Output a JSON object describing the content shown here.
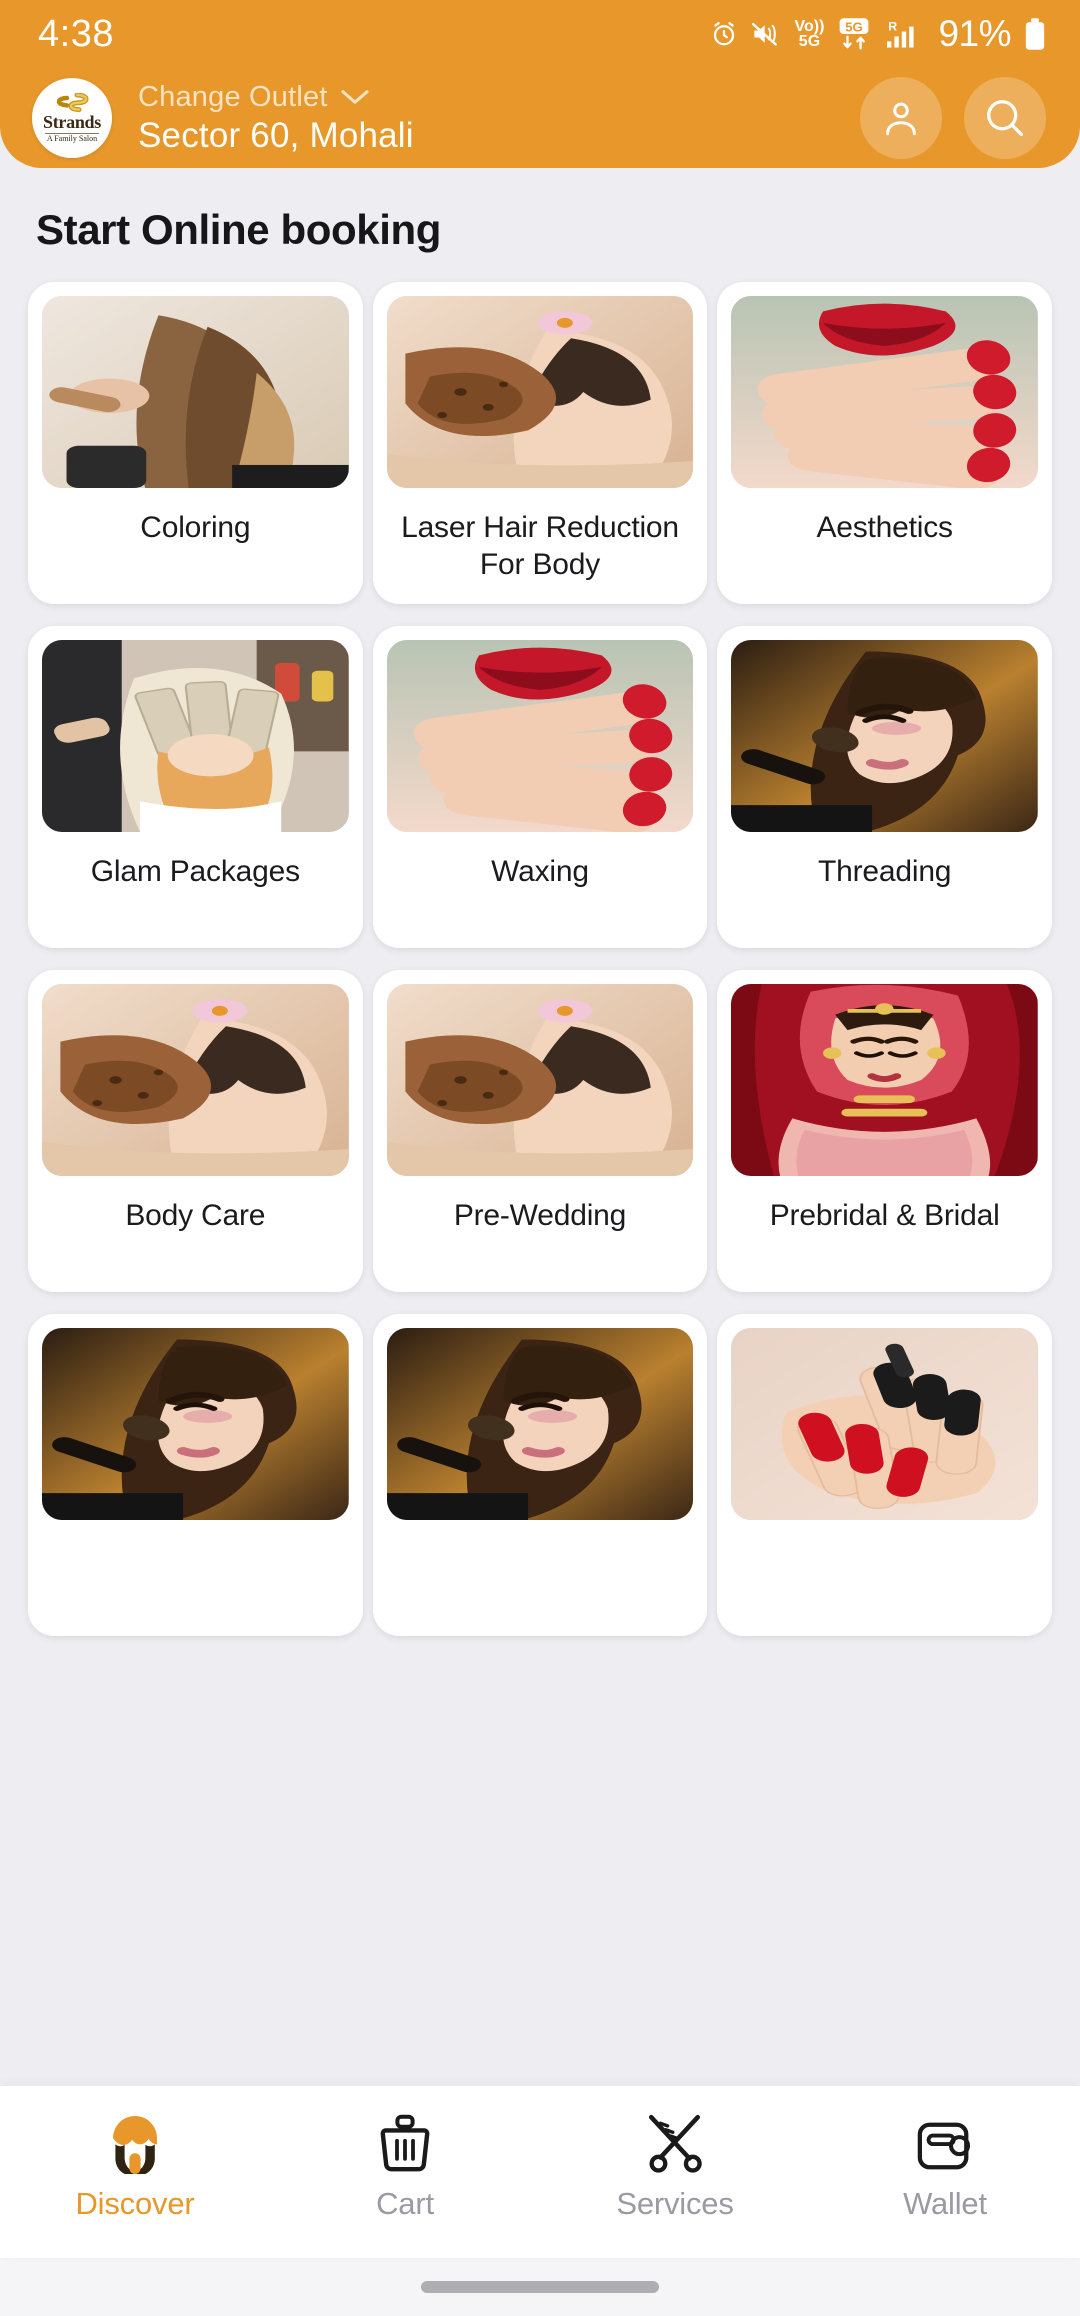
{
  "status_bar": {
    "time": "4:38",
    "battery_percent": "91%",
    "icons": [
      "alarm-icon",
      "mute-icon",
      "volte-5g-icon",
      "5g-data-icon",
      "roaming-signal-icon",
      "battery-icon"
    ],
    "background_color": "#e8972a",
    "text_color": "#ffffff"
  },
  "header": {
    "logo": {
      "name": "Strands",
      "tagline": "A Family Salon"
    },
    "change_outlet_label": "Change Outlet",
    "outlet_name": "Sector 60, Mohali",
    "profile_button": "profile-icon",
    "search_button": "search-icon",
    "accent_color": "#e8972a"
  },
  "main": {
    "section_title": "Start Online booking",
    "services": [
      {
        "label": "Coloring",
        "image": "hair-coloring-photo"
      },
      {
        "label": "Laser Hair Reduction For Body",
        "image": "body-scrub-photo"
      },
      {
        "label": "Aesthetics",
        "image": "red-nails-lips-photo"
      },
      {
        "label": "Glam Packages",
        "image": "hair-foils-photo"
      },
      {
        "label": "Waxing",
        "image": "red-nails-lips-photo"
      },
      {
        "label": "Threading",
        "image": "makeup-brush-photo"
      },
      {
        "label": "Body Care",
        "image": "body-scrub-photo"
      },
      {
        "label": "Pre-Wedding",
        "image": "body-scrub-photo"
      },
      {
        "label": "Prebridal & Bridal",
        "image": "bride-photo"
      },
      {
        "label": "",
        "image": "makeup-brush-photo"
      },
      {
        "label": "",
        "image": "makeup-brush-photo"
      },
      {
        "label": "",
        "image": "red-black-nails-photo"
      }
    ]
  },
  "bottom_nav": {
    "items": [
      {
        "label": "Discover",
        "icon": "discover-face-icon",
        "active": true
      },
      {
        "label": "Cart",
        "icon": "cart-basket-icon",
        "active": false
      },
      {
        "label": "Services",
        "icon": "scissors-icon",
        "active": false
      },
      {
        "label": "Wallet",
        "icon": "wallet-icon",
        "active": false
      }
    ],
    "active_color": "#e8972a",
    "inactive_color": "#9a9aa2"
  }
}
